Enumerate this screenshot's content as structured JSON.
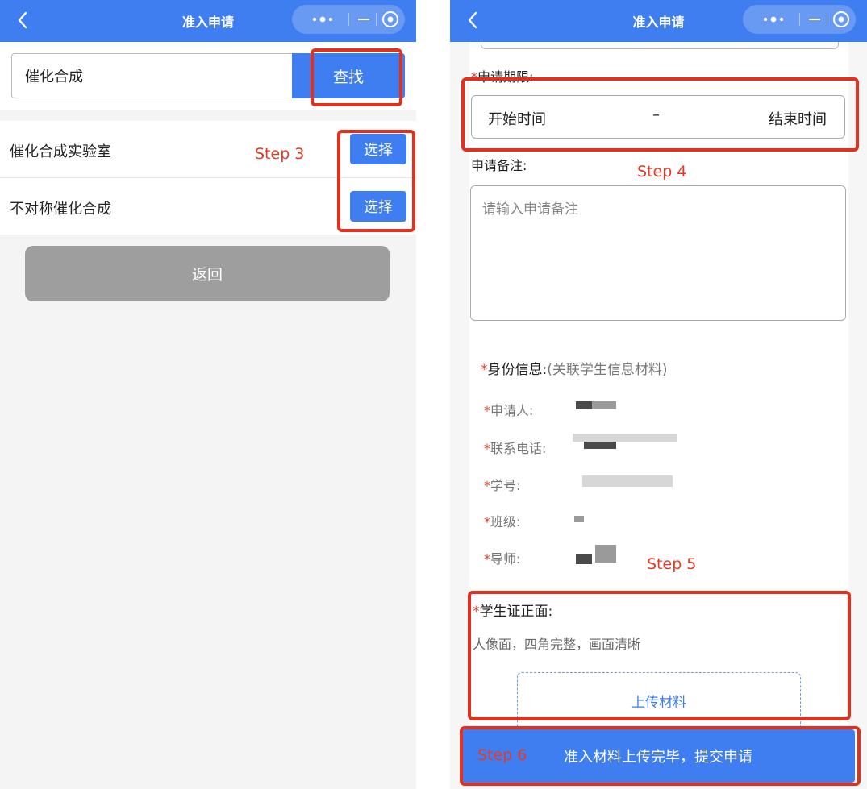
{
  "left": {
    "nav": {
      "title": "准入申请"
    },
    "search": {
      "value": "催化合成",
      "button": "查找"
    },
    "results": [
      {
        "name": "催化合成实验室",
        "action": "选择"
      },
      {
        "name": "不对称催化合成",
        "action": "选择"
      }
    ],
    "back_button": "返回",
    "step_label": "Step 3"
  },
  "right": {
    "nav": {
      "title": "准入申请"
    },
    "period": {
      "label": "申请期限:",
      "start": "开始时间",
      "separator": "–",
      "end": "结束时间"
    },
    "remark": {
      "label": "申请备注:",
      "placeholder": "请输入申请备注"
    },
    "identity": {
      "title": "身份信息:",
      "subtitle": "(关联学生信息材料)",
      "applicant": "申请人:",
      "phone": "联系电话:",
      "student_id": "学号:",
      "class": "班级:",
      "advisor": "导师:"
    },
    "student_card": {
      "title": "学生证正面:",
      "hint": "人像面，四角完整，画面清晰",
      "upload": "上传材料"
    },
    "submit_button": "准入材料上传完毕，提交申请",
    "steps": {
      "four": "Step 4",
      "five": "Step 5",
      "six": "Step 6"
    }
  },
  "colors": {
    "primary": "#3f7ef0",
    "annotation": "#e3301c",
    "back_button": "#9e9e9e"
  },
  "icons": {
    "back": "chevron-left-icon",
    "more": "more-dots-icon",
    "minimize": "minimize-icon",
    "close": "target-close-icon"
  }
}
